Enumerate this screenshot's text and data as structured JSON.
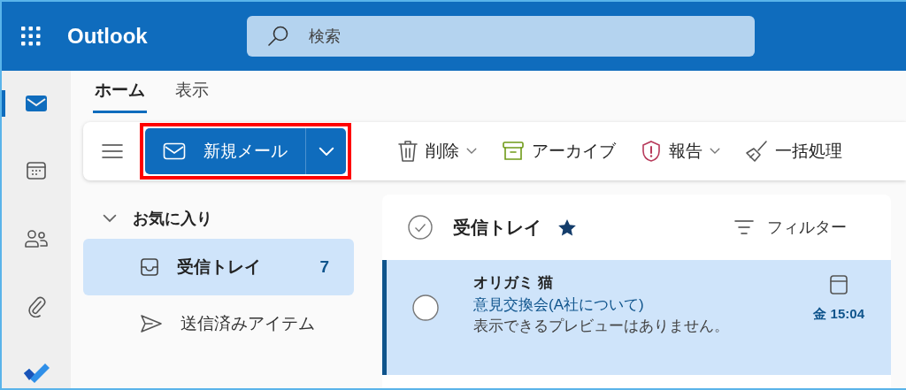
{
  "header": {
    "app_title": "Outlook",
    "search": {
      "placeholder": "検索"
    }
  },
  "rail": [
    {
      "kind": "mail",
      "selected": true
    },
    {
      "kind": "calendar",
      "selected": false
    },
    {
      "kind": "people",
      "selected": false
    },
    {
      "kind": "files",
      "selected": false
    },
    {
      "kind": "todo",
      "selected": false
    }
  ],
  "tabs": [
    {
      "label": "ホーム",
      "selected": true
    },
    {
      "label": "表示",
      "selected": false
    }
  ],
  "toolbar": {
    "new_mail": {
      "label": "新規メール",
      "highlighted": true
    },
    "actions": [
      {
        "kind": "trash",
        "label": "削除",
        "dropdown": true
      },
      {
        "kind": "archive",
        "label": "アーカイブ",
        "dropdown": false
      },
      {
        "kind": "shield",
        "label": "報告",
        "dropdown": true
      },
      {
        "kind": "broom",
        "label": "一括処理",
        "dropdown": false
      }
    ]
  },
  "folders": {
    "group": {
      "label": "お気に入り",
      "expanded": true
    },
    "items": [
      {
        "kind": "inbox",
        "label": "受信トレイ",
        "count": "7",
        "selected": true
      },
      {
        "kind": "sent",
        "label": "送信済みアイテム",
        "selected": false
      }
    ]
  },
  "message_list": {
    "title": "受信トレイ",
    "favorite": true,
    "filter": "フィルター",
    "messages": [
      {
        "sender": "オリガミ 猫",
        "subject": "意見交換会(A社について)",
        "preview": "表示できるプレビューはありません。",
        "time": "金 15:04",
        "selected": true
      }
    ]
  }
}
